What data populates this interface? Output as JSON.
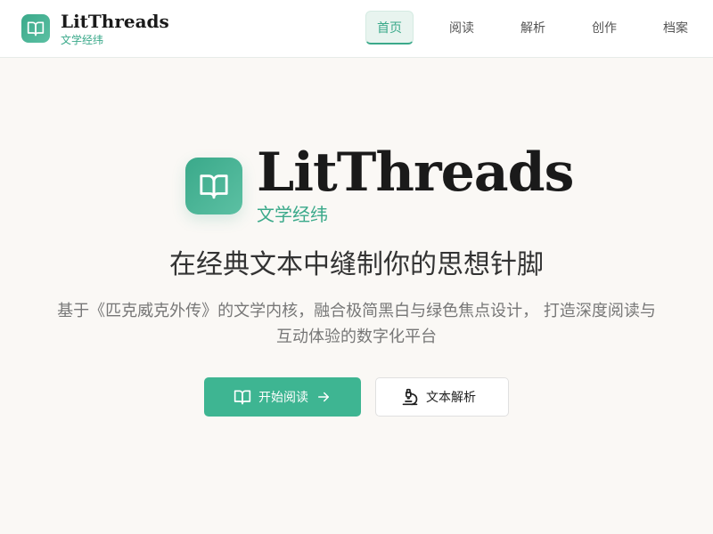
{
  "header": {
    "brand_title": "LitThreads",
    "brand_subtitle": "文学经纬",
    "logo_icon": "book-open-icon",
    "nav": [
      {
        "label": "首页",
        "active": true
      },
      {
        "label": "阅读",
        "active": false
      },
      {
        "label": "解析",
        "active": false
      },
      {
        "label": "创作",
        "active": false
      },
      {
        "label": "档案",
        "active": false
      }
    ]
  },
  "hero": {
    "title": "LitThreads",
    "subtitle": "文学经纬",
    "tagline": "在经典文本中缝制你的思想针脚",
    "description": "基于《匹克威克外传》的文学内核，融合极简黑白与绿色焦点设计， 打造深度阅读与互动体验的数字化平台",
    "primary_button": {
      "label": "开始阅读",
      "icon": "book-open-icon",
      "trailing_icon": "arrow-right-icon"
    },
    "secondary_button": {
      "label": "文本解析",
      "icon": "microscope-icon"
    }
  },
  "colors": {
    "accent": "#3aa98a",
    "button_primary": "#3eb592",
    "background": "#faf8f5",
    "text_dark": "#1a1a1a",
    "text_muted": "#777777"
  }
}
